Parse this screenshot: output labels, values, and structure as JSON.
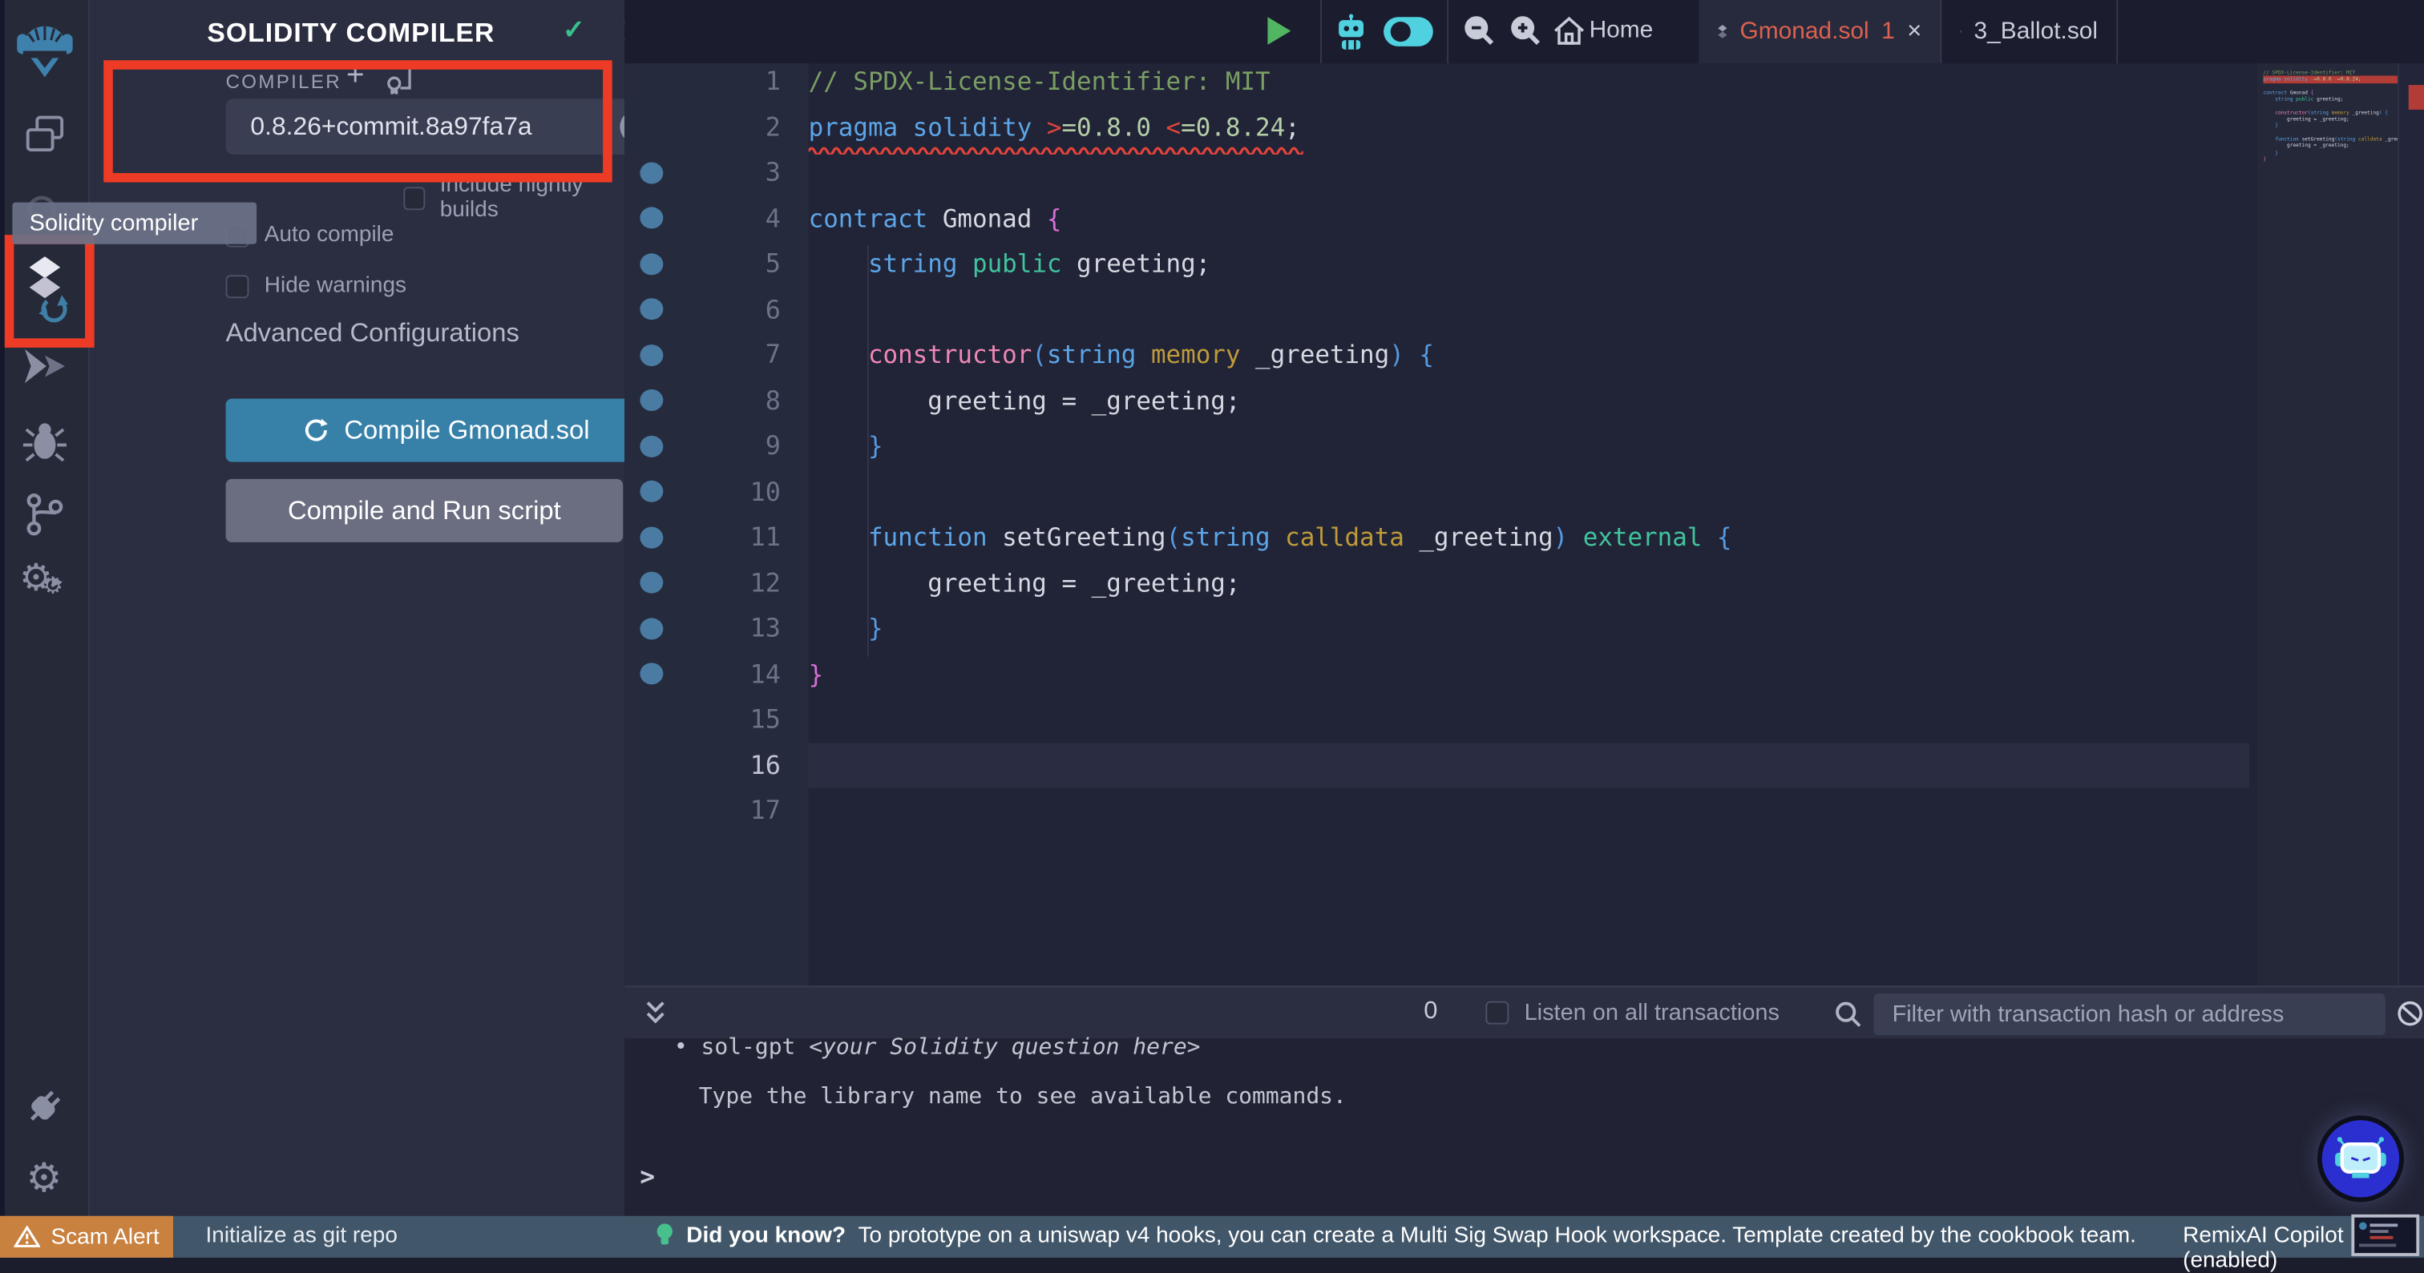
{
  "colors": {
    "accent_blue": "#3781a9",
    "annotation_red": "#ee3b25",
    "status_bar": "#415669",
    "scam_orange": "#c8813f",
    "tab_error_red": "#dd6150",
    "gutter_dot_blue": "#4a7ca3",
    "compile_button_blue": "#3781a9",
    "run_button_gray": "#6a6e80",
    "success_green": "#38c08e",
    "editor_bg": "#212336",
    "panel_bg": "#2b2e40",
    "minimap_error": "#b23c36"
  },
  "icon_bar": {
    "tooltip": "Solidity compiler",
    "icons": [
      "remix-logo",
      "file-explorer-icon",
      "search-icon",
      "solidity-compiler-icon",
      "deploy-run-icon",
      "debugger-icon",
      "source-control-icon",
      "plugin-manager-icon",
      "plug-icon",
      "settings-icon"
    ]
  },
  "panel": {
    "title": "SOLIDITY COMPILER",
    "header_icons": [
      "compiled-check-icon",
      "collapse-chevron-icon",
      "split-view-icon"
    ],
    "section_label": "COMPILER",
    "add_icon": "+",
    "version": "0.8.26+commit.8a97fa7a",
    "nightly_label": "Include nightly builds",
    "autocompile_label": "Auto compile",
    "hidewarnings_label": "Hide warnings",
    "advanced_label": "Advanced Configurations",
    "compile_button": "Compile Gmonad.sol",
    "run_button": "Compile and Run script",
    "info_icon": "i"
  },
  "editor": {
    "toolbar": {
      "home_label": "Home"
    },
    "tabs": [
      {
        "label": "Gmonad.sol",
        "badge": "1",
        "close": "×",
        "state": "error"
      },
      {
        "label": "3_Ballot.sol",
        "state": "normal"
      }
    ],
    "current_line": 16,
    "error_line": 2,
    "total_lines": 17,
    "lines": [
      {
        "n": 1,
        "dot": false,
        "t": [
          [
            "// SPDX-License-Identifier: MIT",
            "comment"
          ]
        ]
      },
      {
        "n": 2,
        "dot": false,
        "t": [
          [
            "pragma solidity ",
            "kw"
          ],
          [
            ">",
            "err"
          ],
          [
            "=0.8.0 ",
            "num"
          ],
          [
            "<",
            "err"
          ],
          [
            "=0.8.24",
            "num"
          ],
          [
            ";",
            "fg"
          ]
        ]
      },
      {
        "n": 3,
        "dot": true,
        "t": []
      },
      {
        "n": 4,
        "dot": true,
        "t": [
          [
            "contract ",
            "kw"
          ],
          [
            "Gmonad ",
            "fg"
          ],
          [
            "{",
            "brace"
          ]
        ]
      },
      {
        "n": 5,
        "dot": true,
        "t": [
          [
            "    ",
            "fg"
          ],
          [
            "string",
            "kw"
          ],
          [
            " ",
            "fg"
          ],
          [
            "public",
            "decl"
          ],
          [
            " greeting;",
            "fg"
          ]
        ]
      },
      {
        "n": 6,
        "dot": true,
        "t": []
      },
      {
        "n": 7,
        "dot": true,
        "t": [
          [
            "    ",
            "fg"
          ],
          [
            "constructor",
            "ctor"
          ],
          [
            "(",
            "paren"
          ],
          [
            "string",
            "kw"
          ],
          [
            " ",
            "fg"
          ],
          [
            "memory",
            "mod"
          ],
          [
            " _greeting",
            "fg"
          ],
          [
            ")",
            "paren"
          ],
          [
            " {",
            "paren"
          ]
        ]
      },
      {
        "n": 8,
        "dot": true,
        "t": [
          [
            "        greeting = _greeting;",
            "fg"
          ]
        ]
      },
      {
        "n": 9,
        "dot": true,
        "t": [
          [
            "    }",
            "paren"
          ]
        ]
      },
      {
        "n": 10,
        "dot": true,
        "t": []
      },
      {
        "n": 11,
        "dot": true,
        "t": [
          [
            "    ",
            "fg"
          ],
          [
            "function",
            "kw"
          ],
          [
            " setGreeting",
            "fg"
          ],
          [
            "(",
            "paren"
          ],
          [
            "string",
            "kw"
          ],
          [
            " ",
            "fg"
          ],
          [
            "calldata",
            "mod"
          ],
          [
            " _greeting",
            "fg"
          ],
          [
            ")",
            "paren"
          ],
          [
            " ",
            "fg"
          ],
          [
            "external",
            "decl"
          ],
          [
            " {",
            "paren"
          ]
        ]
      },
      {
        "n": 12,
        "dot": true,
        "t": [
          [
            "        greeting = _greeting;",
            "fg"
          ]
        ]
      },
      {
        "n": 13,
        "dot": true,
        "t": [
          [
            "    }",
            "paren"
          ]
        ]
      },
      {
        "n": 14,
        "dot": true,
        "t": [
          [
            "}",
            "brace"
          ]
        ]
      },
      {
        "n": 15,
        "dot": false,
        "t": []
      },
      {
        "n": 16,
        "dot": false,
        "t": []
      },
      {
        "n": 17,
        "dot": false,
        "t": []
      }
    ]
  },
  "terminal": {
    "badge_count": "0",
    "listen_label": "Listen on all transactions",
    "filter_placeholder": "Filter with transaction hash or address",
    "bullet": "•",
    "command": "sol-gpt ",
    "command_hint": "<your Solidity question here>",
    "help_line": "Type the library name to see available commands.",
    "prompt": ">"
  },
  "status_bar": {
    "scam_label": "Scam Alert",
    "git_label": "Initialize as git repo",
    "tip_title": "Did you know?",
    "tip_body": "To prototype on a uniswap v4 hooks, you can create a Multi Sig Swap Hook workspace. Template created by the cookbook team.",
    "copilot_label": "RemixAI Copilot (enabled)"
  }
}
